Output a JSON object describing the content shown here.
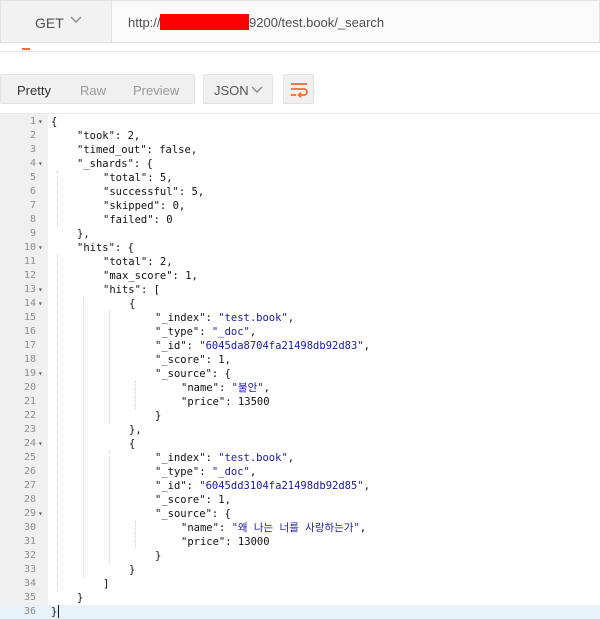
{
  "request": {
    "method": "GET",
    "url_prefix": "http://",
    "url_suffix": "9200/test.book/_search"
  },
  "response_toolbar": {
    "views": [
      "Pretty",
      "Raw",
      "Preview"
    ],
    "active_view": "Pretty",
    "format": "JSON",
    "wrap_icon": "wrap-lines-icon"
  },
  "colors": {
    "accent": "#f26b3a",
    "redaction": "#ff0000",
    "string": "#1a1aa6",
    "active_line": "#e8f2fb"
  },
  "editor": {
    "active_line": 36,
    "lines": [
      {
        "n": "1",
        "indent": 0,
        "fold": true,
        "tokens": [
          [
            "p",
            "{"
          ]
        ]
      },
      {
        "n": "2",
        "indent": 1,
        "tokens": [
          [
            "k",
            "\"took\""
          ],
          [
            "p",
            ": "
          ],
          [
            "n",
            "2"
          ],
          [
            "p",
            ","
          ]
        ]
      },
      {
        "n": "3",
        "indent": 1,
        "tokens": [
          [
            "k",
            "\"timed_out\""
          ],
          [
            "p",
            ": "
          ],
          [
            "n",
            "false"
          ],
          [
            "p",
            ","
          ]
        ]
      },
      {
        "n": "4",
        "indent": 1,
        "fold": true,
        "tokens": [
          [
            "k",
            "\"_shards\""
          ],
          [
            "p",
            ": {"
          ]
        ]
      },
      {
        "n": "5",
        "indent": 2,
        "tokens": [
          [
            "k",
            "\"total\""
          ],
          [
            "p",
            ": "
          ],
          [
            "n",
            "5"
          ],
          [
            "p",
            ","
          ]
        ]
      },
      {
        "n": "6",
        "indent": 2,
        "tokens": [
          [
            "k",
            "\"successful\""
          ],
          [
            "p",
            ": "
          ],
          [
            "n",
            "5"
          ],
          [
            "p",
            ","
          ]
        ]
      },
      {
        "n": "7",
        "indent": 2,
        "tokens": [
          [
            "k",
            "\"skipped\""
          ],
          [
            "p",
            ": "
          ],
          [
            "n",
            "0"
          ],
          [
            "p",
            ","
          ]
        ]
      },
      {
        "n": "8",
        "indent": 2,
        "tokens": [
          [
            "k",
            "\"failed\""
          ],
          [
            "p",
            ": "
          ],
          [
            "n",
            "0"
          ]
        ]
      },
      {
        "n": "9",
        "indent": 1,
        "tokens": [
          [
            "p",
            "},"
          ]
        ]
      },
      {
        "n": "10",
        "indent": 1,
        "fold": true,
        "tokens": [
          [
            "k",
            "\"hits\""
          ],
          [
            "p",
            ": {"
          ]
        ]
      },
      {
        "n": "11",
        "indent": 2,
        "tokens": [
          [
            "k",
            "\"total\""
          ],
          [
            "p",
            ": "
          ],
          [
            "n",
            "2"
          ],
          [
            "p",
            ","
          ]
        ]
      },
      {
        "n": "12",
        "indent": 2,
        "tokens": [
          [
            "k",
            "\"max_score\""
          ],
          [
            "p",
            ": "
          ],
          [
            "n",
            "1"
          ],
          [
            "p",
            ","
          ]
        ]
      },
      {
        "n": "13",
        "indent": 2,
        "fold": true,
        "tokens": [
          [
            "k",
            "\"hits\""
          ],
          [
            "p",
            ": ["
          ]
        ]
      },
      {
        "n": "14",
        "indent": 3,
        "fold": true,
        "tokens": [
          [
            "p",
            "{"
          ]
        ]
      },
      {
        "n": "15",
        "indent": 4,
        "tokens": [
          [
            "k",
            "\"_index\""
          ],
          [
            "p",
            ": "
          ],
          [
            "s",
            "\"test.book\""
          ],
          [
            "p",
            ","
          ]
        ]
      },
      {
        "n": "16",
        "indent": 4,
        "tokens": [
          [
            "k",
            "\"_type\""
          ],
          [
            "p",
            ": "
          ],
          [
            "s",
            "\"_doc\""
          ],
          [
            "p",
            ","
          ]
        ]
      },
      {
        "n": "17",
        "indent": 4,
        "tokens": [
          [
            "k",
            "\"_id\""
          ],
          [
            "p",
            ": "
          ],
          [
            "s",
            "\"6045da8704fa21498db92d83\""
          ],
          [
            "p",
            ","
          ]
        ]
      },
      {
        "n": "18",
        "indent": 4,
        "tokens": [
          [
            "k",
            "\"_score\""
          ],
          [
            "p",
            ": "
          ],
          [
            "n",
            "1"
          ],
          [
            "p",
            ","
          ]
        ]
      },
      {
        "n": "19",
        "indent": 4,
        "fold": true,
        "tokens": [
          [
            "k",
            "\"_source\""
          ],
          [
            "p",
            ": {"
          ]
        ]
      },
      {
        "n": "20",
        "indent": 5,
        "tokens": [
          [
            "k",
            "\"name\""
          ],
          [
            "p",
            ": "
          ],
          [
            "s",
            "\"불안\""
          ],
          [
            "p",
            ","
          ]
        ]
      },
      {
        "n": "21",
        "indent": 5,
        "tokens": [
          [
            "k",
            "\"price\""
          ],
          [
            "p",
            ": "
          ],
          [
            "n",
            "13500"
          ]
        ]
      },
      {
        "n": "22",
        "indent": 4,
        "tokens": [
          [
            "p",
            "}"
          ]
        ]
      },
      {
        "n": "23",
        "indent": 3,
        "tokens": [
          [
            "p",
            "},"
          ]
        ]
      },
      {
        "n": "24",
        "indent": 3,
        "fold": true,
        "tokens": [
          [
            "p",
            "{"
          ]
        ]
      },
      {
        "n": "25",
        "indent": 4,
        "tokens": [
          [
            "k",
            "\"_index\""
          ],
          [
            "p",
            ": "
          ],
          [
            "s",
            "\"test.book\""
          ],
          [
            "p",
            ","
          ]
        ]
      },
      {
        "n": "26",
        "indent": 4,
        "tokens": [
          [
            "k",
            "\"_type\""
          ],
          [
            "p",
            ": "
          ],
          [
            "s",
            "\"_doc\""
          ],
          [
            "p",
            ","
          ]
        ]
      },
      {
        "n": "27",
        "indent": 4,
        "tokens": [
          [
            "k",
            "\"_id\""
          ],
          [
            "p",
            ": "
          ],
          [
            "s",
            "\"6045dd3104fa21498db92d85\""
          ],
          [
            "p",
            ","
          ]
        ]
      },
      {
        "n": "28",
        "indent": 4,
        "tokens": [
          [
            "k",
            "\"_score\""
          ],
          [
            "p",
            ": "
          ],
          [
            "n",
            "1"
          ],
          [
            "p",
            ","
          ]
        ]
      },
      {
        "n": "29",
        "indent": 4,
        "fold": true,
        "tokens": [
          [
            "k",
            "\"_source\""
          ],
          [
            "p",
            ": {"
          ]
        ]
      },
      {
        "n": "30",
        "indent": 5,
        "tokens": [
          [
            "k",
            "\"name\""
          ],
          [
            "p",
            ": "
          ],
          [
            "s",
            "\"왜 나는 너를 사랑하는가\""
          ],
          [
            "p",
            ","
          ]
        ]
      },
      {
        "n": "31",
        "indent": 5,
        "tokens": [
          [
            "k",
            "\"price\""
          ],
          [
            "p",
            ": "
          ],
          [
            "n",
            "13000"
          ]
        ]
      },
      {
        "n": "32",
        "indent": 4,
        "tokens": [
          [
            "p",
            "}"
          ]
        ]
      },
      {
        "n": "33",
        "indent": 3,
        "tokens": [
          [
            "p",
            "}"
          ]
        ]
      },
      {
        "n": "34",
        "indent": 2,
        "tokens": [
          [
            "p",
            "]"
          ]
        ]
      },
      {
        "n": "35",
        "indent": 1,
        "tokens": [
          [
            "p",
            "}"
          ]
        ]
      },
      {
        "n": "36",
        "indent": 0,
        "tokens": [
          [
            "p",
            "}"
          ]
        ]
      }
    ]
  }
}
